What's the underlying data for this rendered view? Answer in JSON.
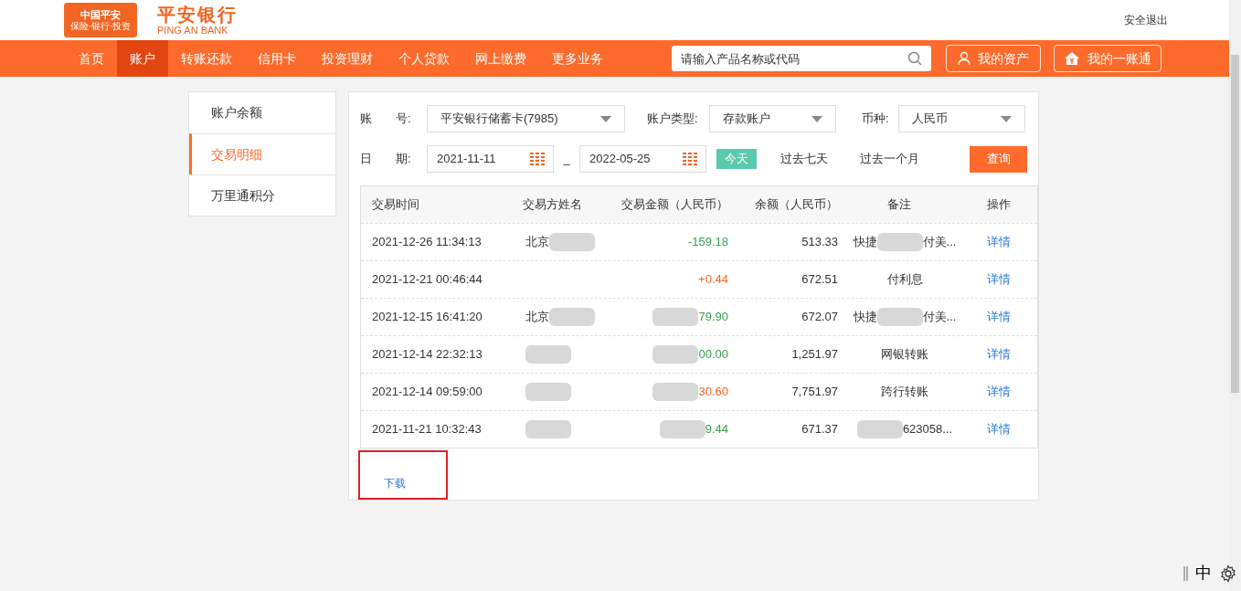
{
  "header": {
    "logo_badge": "中国平安",
    "logo_badge_sub": "保险·银行·投资",
    "bank_name": "平安银行",
    "bank_name_en": "PING AN BANK",
    "logout": "安全退出"
  },
  "nav": [
    {
      "label": "首页",
      "selected": false
    },
    {
      "label": "账户",
      "selected": true
    },
    {
      "label": "转账还款",
      "selected": false
    },
    {
      "label": "信用卡",
      "selected": false
    },
    {
      "label": "投资理财",
      "selected": false
    },
    {
      "label": "个人贷款",
      "selected": false
    },
    {
      "label": "网上缴费",
      "selected": false
    },
    {
      "label": "更多业务",
      "selected": false
    }
  ],
  "search": {
    "placeholder": "请输入产品名称或代码"
  },
  "header_buttons": [
    {
      "kind": "person",
      "label": "我的资产"
    },
    {
      "kind": "home",
      "label": "我的一账通"
    }
  ],
  "sidebar": [
    {
      "label": "账户余额",
      "selected": false
    },
    {
      "label": "交易明细",
      "selected": true
    },
    {
      "label": "万里通积分",
      "selected": false
    }
  ],
  "filters": {
    "account_label": "账　　号:",
    "account": "平安银行储蓄卡(7985)",
    "type_label": "账户类型:",
    "type": "存款账户",
    "currency_label": "币种:",
    "currency": "人民币",
    "date_label": "日　　期:",
    "date_from": "2021-11-11",
    "date_sep": "_",
    "date_to": "2022-05-25",
    "quick": [
      {
        "label": "今天",
        "selected": true
      },
      {
        "label": "过去七天",
        "selected": false
      },
      {
        "label": "过去一个月",
        "selected": false
      }
    ],
    "query": "查询"
  },
  "table": {
    "columns": [
      "交易时间",
      "交易方姓名",
      "交易金额（人民币）",
      "余额（人民币）",
      "备注",
      "操作"
    ],
    "rows": [
      {
        "time": "2021-12-26 11:34:13",
        "party": [
          {
            "kind": "text",
            "text": "北京"
          },
          {
            "kind": "blur"
          }
        ],
        "amount": [
          {
            "kind": "text",
            "text": "-159.18"
          }
        ],
        "color": "#3aa04b",
        "balance": "513.33",
        "remark": [
          {
            "kind": "text",
            "text": "快捷"
          },
          {
            "kind": "blur"
          },
          {
            "kind": "text",
            "text": "付美..."
          }
        ],
        "action": "详情"
      },
      {
        "time": "2021-12-21 00:46:44",
        "party": [],
        "amount": [
          {
            "kind": "text",
            "text": "+0.44"
          }
        ],
        "color": "#f26522",
        "balance": "672.51",
        "remark": [
          {
            "kind": "text",
            "text": "付利息"
          }
        ],
        "action": "详情"
      },
      {
        "time": "2021-12-15 16:41:20",
        "party": [
          {
            "kind": "text",
            "text": "北京"
          },
          {
            "kind": "blur"
          }
        ],
        "amount": [
          {
            "kind": "blur"
          },
          {
            "kind": "text",
            "text": "79.90"
          }
        ],
        "color": "#3aa04b",
        "balance": "672.07",
        "remark": [
          {
            "kind": "text",
            "text": "快捷"
          },
          {
            "kind": "blur"
          },
          {
            "kind": "text",
            "text": "付美..."
          }
        ],
        "action": "详情"
      },
      {
        "time": "2021-12-14 22:32:13",
        "party": [
          {
            "kind": "blur"
          }
        ],
        "amount": [
          {
            "kind": "blur"
          },
          {
            "kind": "text",
            "text": "00.00"
          }
        ],
        "color": "#3aa04b",
        "balance": "1,251.97",
        "remark": [
          {
            "kind": "text",
            "text": "网银转账"
          }
        ],
        "action": "详情"
      },
      {
        "time": "2021-12-14 09:59:00",
        "party": [
          {
            "kind": "blur"
          }
        ],
        "amount": [
          {
            "kind": "blur"
          },
          {
            "kind": "text",
            "text": "30.60"
          }
        ],
        "color": "#f26522",
        "balance": "7,751.97",
        "remark": [
          {
            "kind": "text",
            "text": "跨行转账"
          }
        ],
        "action": "详情"
      },
      {
        "time": "2021-11-21 10:32:43",
        "party": [
          {
            "kind": "blur"
          }
        ],
        "amount": [
          {
            "kind": "blur"
          },
          {
            "kind": "text",
            "text": "9.44"
          }
        ],
        "color": "#3aa04b",
        "balance": "671.37",
        "remark": [
          {
            "kind": "blur"
          },
          {
            "kind": "text",
            "text": "623058..."
          }
        ],
        "action": "详情"
      }
    ]
  },
  "download": {
    "label": "下载",
    "highlighted": true
  },
  "ime": {
    "label": "中"
  }
}
